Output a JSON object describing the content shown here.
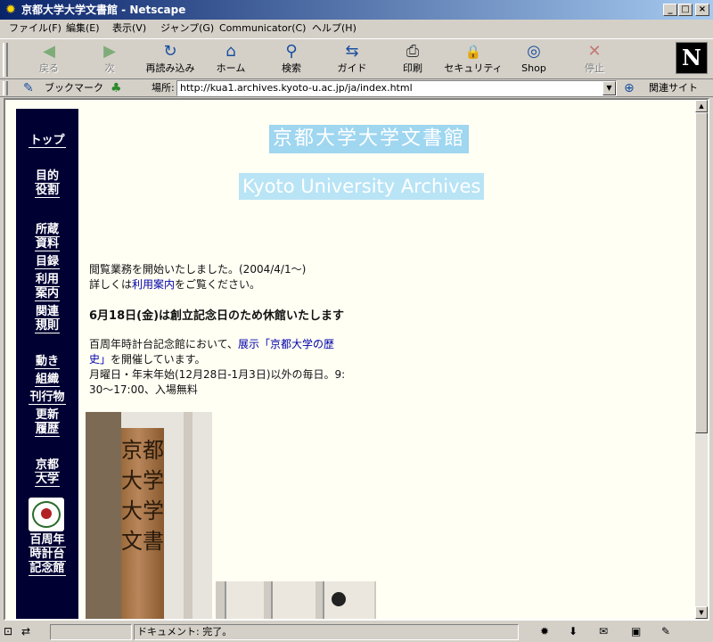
{
  "window": {
    "title": "京都大学大学文書館 - Netscape",
    "btn_min": "_",
    "btn_max": "□",
    "btn_close": "×",
    "app_icon_glyph": "✹"
  },
  "menu": [
    "ファイル(F)",
    "編集(E)",
    "表示(V)",
    "ジャンプ(G)",
    "Communicator(C)",
    "ヘルプ(H)"
  ],
  "toolbar": {
    "buttons": [
      {
        "label": "戻る",
        "icon": "back-arrow-icon",
        "glyph": "◀",
        "disabled": true
      },
      {
        "label": "次",
        "icon": "forward-arrow-icon",
        "glyph": "▶",
        "disabled": true
      },
      {
        "label": "再読み込み",
        "icon": "reload-icon",
        "glyph": "↻",
        "disabled": false
      },
      {
        "label": "ホーム",
        "icon": "home-icon",
        "glyph": "⌂",
        "disabled": false
      },
      {
        "label": "検索",
        "icon": "search-icon",
        "glyph": "⚲",
        "disabled": false
      },
      {
        "label": "ガイド",
        "icon": "guide-icon",
        "glyph": "⇆",
        "disabled": false
      },
      {
        "label": "印刷",
        "icon": "print-icon",
        "glyph": "⎙",
        "disabled": false
      },
      {
        "label": "セキュリティ",
        "icon": "lock-icon",
        "glyph": "🔒",
        "disabled": false
      },
      {
        "label": "Shop",
        "icon": "shop-icon",
        "glyph": "◎",
        "disabled": false
      },
      {
        "label": "停止",
        "icon": "stop-icon",
        "glyph": "✕",
        "disabled": true
      }
    ],
    "logo": "N"
  },
  "location": {
    "bookmarks_label": "ブックマーク",
    "location_label": "場所:",
    "url": "http://kua1.archives.kyoto-u.ac.jp/ja/index.html",
    "related_label": "関連サイト",
    "dropdown_glyph": "▼",
    "bookmark_glyph": "✎",
    "location_glyph": "♣",
    "related_glyph": "⊕"
  },
  "sidenav": {
    "items": [
      [
        "トップ"
      ],
      [
        "目的",
        "役割"
      ],
      [
        "所蔵",
        "資料"
      ],
      [
        "目録"
      ],
      [
        "利用",
        "案内"
      ],
      [
        "関連",
        "規則"
      ],
      [
        "動き"
      ],
      [
        "組織"
      ],
      [
        "刊行物"
      ],
      [
        "更新",
        "履歴"
      ],
      [
        "京都",
        "大学"
      ],
      [
        "百周年",
        "時計台",
        "記念館"
      ]
    ]
  },
  "page": {
    "title_ja": "京都大学大学文書館",
    "title_en": "Kyoto University Archives",
    "notice_line1": "閲覧業務を開始いたしました。(2004/4/1～)",
    "notice_pre": "詳しくは",
    "notice_link": "利用案内",
    "notice_post": "をご覧ください。",
    "closure": "6月18日(金)は創立記念日のため休館いたします",
    "exhibit_pre": "百周年時計台記念館において、",
    "exhibit_link_a": "展示「京都大学の歴",
    "exhibit_link_b": "史」",
    "exhibit_post": "を開催しています。",
    "hours_line1": "月曜日・年末年始(12月28日-1月3日)以外の毎日。9:",
    "hours_line2": "30～17:00、入場無料",
    "photo_board_text": "京都大学大学文書"
  },
  "status": {
    "text": "ドキュメント: 完了。",
    "icons": {
      "left1": "⊡",
      "left2": "⇄",
      "r1": "✹",
      "r2": "⬇",
      "r3": "✉",
      "r4": "▣",
      "r5": "✎"
    }
  }
}
